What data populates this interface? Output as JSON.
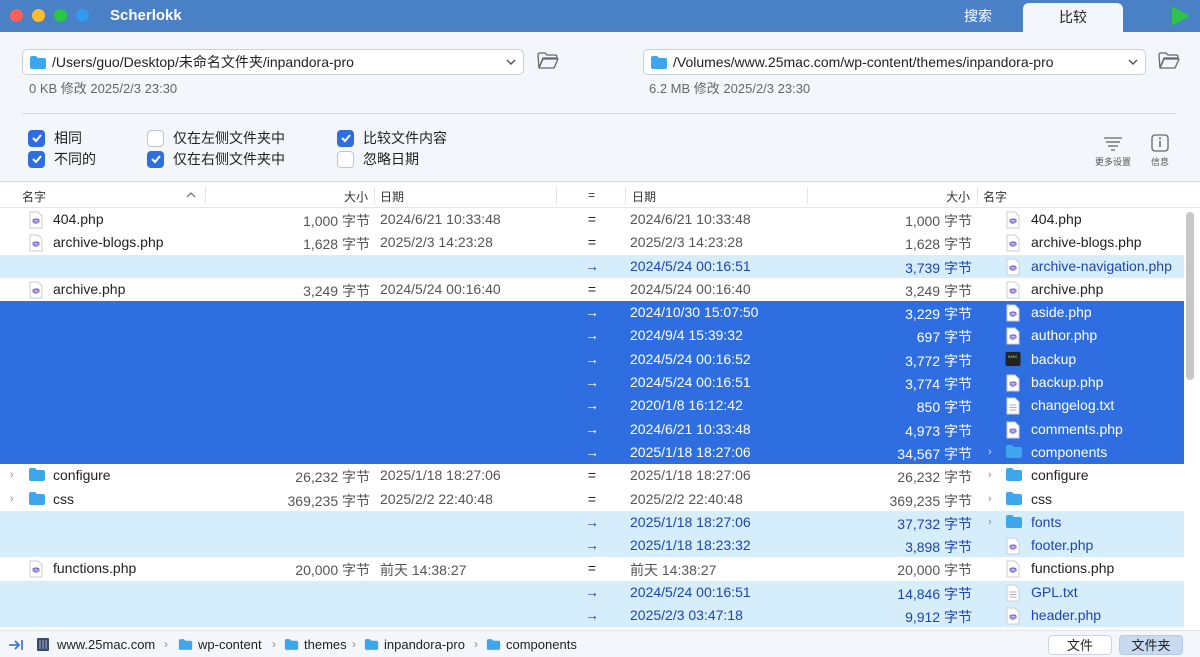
{
  "app": {
    "title": "Scherlokk",
    "tab_search": "搜索",
    "tab_compare": "比较"
  },
  "left": {
    "path": "/Users/guo/Desktop/未命名文件夹/inpandora-pro",
    "info": "0 KB 修改 2025/2/3 23:30"
  },
  "right": {
    "path": "/Volumes/www.25mac.com/wp-content/themes/inpandora-pro",
    "info": "6.2 MB 修改 2025/2/3 23:30"
  },
  "options": {
    "same": {
      "label": "相同",
      "checked": true
    },
    "different": {
      "label": "不同的",
      "checked": true
    },
    "left_only": {
      "label": "仅在左侧文件夹中",
      "checked": false
    },
    "right_only": {
      "label": "仅在右侧文件夹中",
      "checked": true
    },
    "compare_content": {
      "label": "比较文件内容",
      "checked": true
    },
    "ignore_date": {
      "label": "忽略日期",
      "checked": false
    }
  },
  "tools": {
    "more": "更多设置",
    "info": "信息"
  },
  "columns": {
    "name": "名字",
    "size": "大小",
    "date": "日期",
    "eq": "="
  },
  "rows": [
    {
      "status": "same",
      "lname": "404.php",
      "lsize": "1,000 字节",
      "ldate": "2024/6/21 10:33:48",
      "eq": "=",
      "rdate": "2024/6/21 10:33:48",
      "rsize": "1,000 字节",
      "rname": "404.php",
      "icon": "php"
    },
    {
      "status": "same",
      "lname": "archive-blogs.php",
      "lsize": "1,628 字节",
      "ldate": "2025/2/3 14:23:28",
      "eq": "=",
      "rdate": "2025/2/3 14:23:28",
      "rsize": "1,628 字节",
      "rname": "archive-blogs.php",
      "icon": "php"
    },
    {
      "status": "rightonly",
      "lname": "",
      "lsize": "",
      "ldate": "",
      "eq": "→",
      "rdate": "2024/5/24 00:16:51",
      "rsize": "3,739 字节",
      "rname": "archive-navigation.php",
      "icon": "php"
    },
    {
      "status": "same",
      "lname": "archive.php",
      "lsize": "3,249 字节",
      "ldate": "2024/5/24 00:16:40",
      "eq": "=",
      "rdate": "2024/5/24 00:16:40",
      "rsize": "3,249 字节",
      "rname": "archive.php",
      "icon": "php"
    },
    {
      "status": "selected",
      "lname": "",
      "lsize": "",
      "ldate": "",
      "eq": "→",
      "rdate": "2024/10/30 15:07:50",
      "rsize": "3,229 字节",
      "rname": "aside.php",
      "icon": "php"
    },
    {
      "status": "selected",
      "lname": "",
      "lsize": "",
      "ldate": "",
      "eq": "→",
      "rdate": "2024/9/4 15:39:32",
      "rsize": "697 字节",
      "rname": "author.php",
      "icon": "php"
    },
    {
      "status": "selected",
      "lname": "",
      "lsize": "",
      "ldate": "",
      "eq": "→",
      "rdate": "2024/5/24 00:16:52",
      "rsize": "3,772 字节",
      "rname": "backup",
      "icon": "exec"
    },
    {
      "status": "selected",
      "lname": "",
      "lsize": "",
      "ldate": "",
      "eq": "→",
      "rdate": "2024/5/24 00:16:51",
      "rsize": "3,774 字节",
      "rname": "backup.php",
      "icon": "php"
    },
    {
      "status": "selected",
      "lname": "",
      "lsize": "",
      "ldate": "",
      "eq": "→",
      "rdate": "2020/1/8 16:12:42",
      "rsize": "850 字节",
      "rname": "changelog.txt",
      "icon": "txt"
    },
    {
      "status": "selected",
      "lname": "",
      "lsize": "",
      "ldate": "",
      "eq": "→",
      "rdate": "2024/6/21 10:33:48",
      "rsize": "4,973 字节",
      "rname": "comments.php",
      "icon": "php"
    },
    {
      "status": "selected",
      "lname": "",
      "lsize": "",
      "ldate": "",
      "eq": "→",
      "rdate": "2025/1/18 18:27:06",
      "rsize": "34,567 字节",
      "rname": "components",
      "icon": "folder",
      "rexp": true
    },
    {
      "status": "same",
      "lname": "configure",
      "lsize": "26,232 字节",
      "ldate": "2025/1/18 18:27:06",
      "eq": "=",
      "rdate": "2025/1/18 18:27:06",
      "rsize": "26,232 字节",
      "rname": "configure",
      "icon": "folder",
      "lexp": true,
      "rexp": true
    },
    {
      "status": "same",
      "lname": "css",
      "lsize": "369,235 字节",
      "ldate": "2025/2/2 22:40:48",
      "eq": "=",
      "rdate": "2025/2/2 22:40:48",
      "rsize": "369,235 字节",
      "rname": "css",
      "icon": "folder",
      "lexp": true,
      "rexp": true
    },
    {
      "status": "rightonly",
      "lname": "",
      "lsize": "",
      "ldate": "",
      "eq": "→",
      "rdate": "2025/1/18 18:27:06",
      "rsize": "37,732 字节",
      "rname": "fonts",
      "icon": "folder",
      "rexp": true
    },
    {
      "status": "rightonly",
      "lname": "",
      "lsize": "",
      "ldate": "",
      "eq": "→",
      "rdate": "2025/1/18 18:23:32",
      "rsize": "3,898 字节",
      "rname": "footer.php",
      "icon": "php"
    },
    {
      "status": "same",
      "lname": "functions.php",
      "lsize": "20,000 字节",
      "ldate": "前天 14:38:27",
      "eq": "=",
      "rdate": "前天 14:38:27",
      "rsize": "20,000 字节",
      "rname": "functions.php",
      "icon": "php"
    },
    {
      "status": "rightonly",
      "lname": "",
      "lsize": "",
      "ldate": "",
      "eq": "→",
      "rdate": "2024/5/24 00:16:51",
      "rsize": "14,846 字节",
      "rname": "GPL.txt",
      "icon": "txt"
    },
    {
      "status": "rightonly",
      "lname": "",
      "lsize": "",
      "ldate": "",
      "eq": "→",
      "rdate": "2025/2/3 03:47:18",
      "rsize": "9,912 字节",
      "rname": "header.php",
      "icon": "php"
    }
  ],
  "status": {
    "crumbs": [
      "www.25mac.com",
      "wp-content",
      "themes",
      "inpandora-pro",
      "components"
    ],
    "btn_file": "文件",
    "btn_folder": "文件夹"
  }
}
